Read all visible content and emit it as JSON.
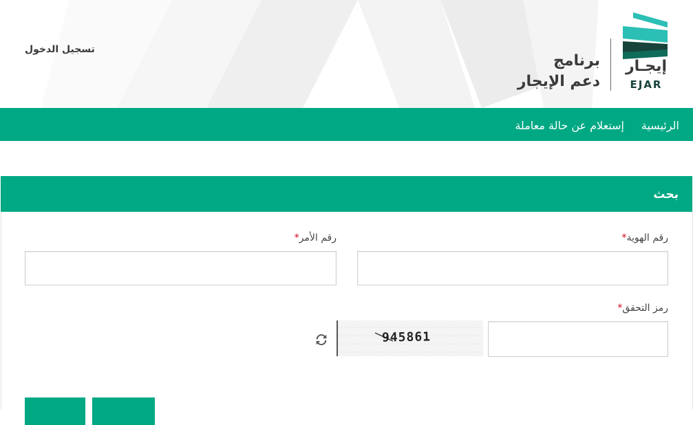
{
  "header": {
    "login_label": "تسجيل الدخول",
    "program_line1": "برنامج",
    "program_line2": "دعم الإيجار",
    "logo_ar": "إيجـار",
    "logo_en": "EJAR"
  },
  "nav": {
    "items": [
      {
        "label": "الرئيسية"
      },
      {
        "label": "إستعلام عن حالة معاملة"
      }
    ]
  },
  "search": {
    "title": "بحث",
    "id_label": "رقم الهوية",
    "order_label": "رقم الأمر",
    "captcha_label": "رمز التحقق",
    "required_mark": "*",
    "id_value": "",
    "order_value": "",
    "captcha_value": "",
    "captcha_code": "945861"
  },
  "colors": {
    "brand_green": "#00a884",
    "logo_teal": "#2bbfb5",
    "logo_dark": "#17433b",
    "required": "#d0021b"
  },
  "icons": {
    "refresh": "refresh-icon",
    "logo": "ejar-logo-icon"
  }
}
